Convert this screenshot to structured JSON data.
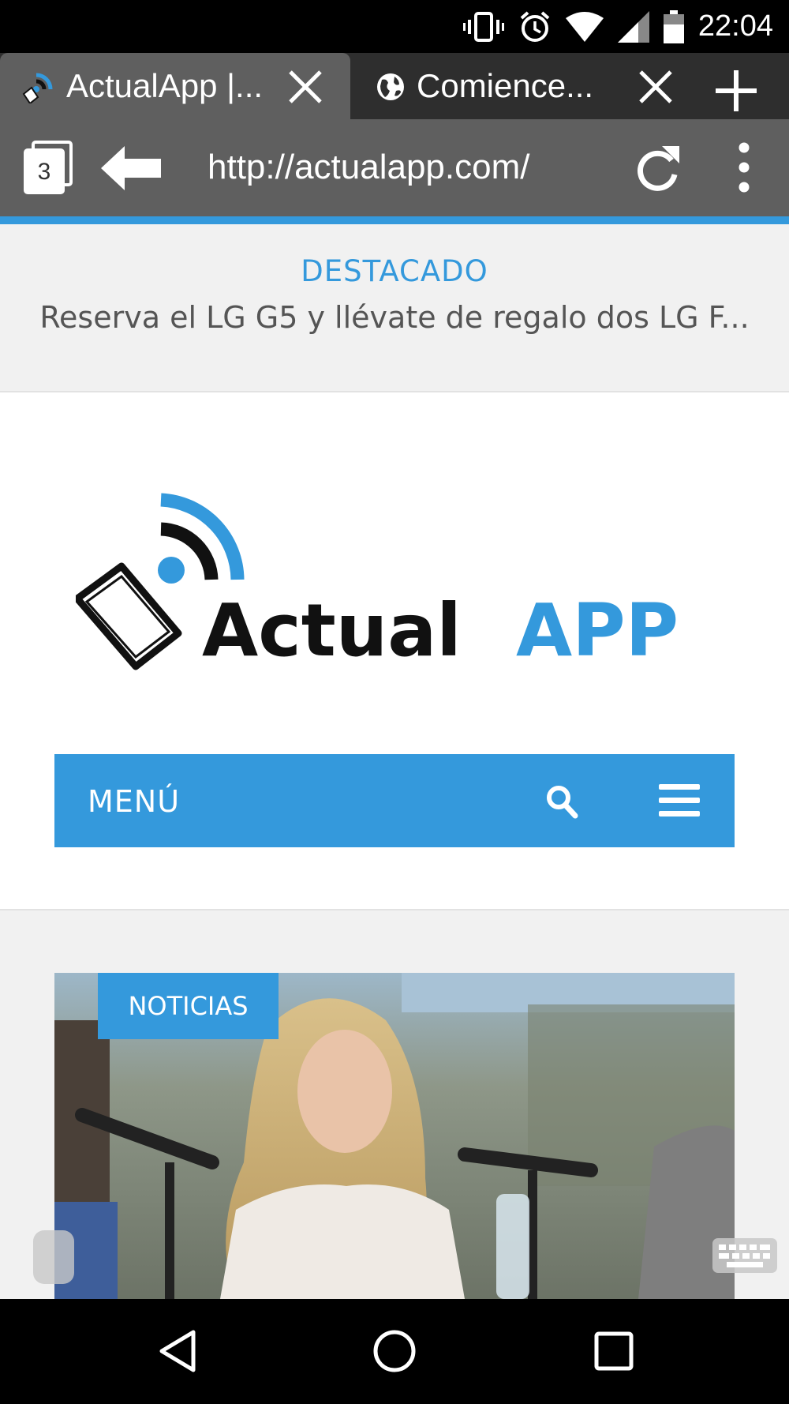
{
  "status_bar": {
    "time": "22:04",
    "icons": [
      "vibrate-icon",
      "alarm-icon",
      "wifi-icon",
      "signal-icon",
      "battery-icon"
    ]
  },
  "tabs": [
    {
      "title": "ActualApp |...",
      "active": true,
      "favicon": "actualapp-favicon"
    },
    {
      "title": "Comience...",
      "active": false,
      "favicon": "globe-icon"
    }
  ],
  "toolbar": {
    "tab_count": "3",
    "url": "http://actualapp.com/"
  },
  "featured": {
    "label": "DESTACADO",
    "headline": "Reserva el LG G5 y llévate de regalo dos LG F..."
  },
  "logo": {
    "word_dark": "Actual",
    "word_blue": "APP"
  },
  "menu": {
    "label": "MENÚ"
  },
  "article": {
    "category": "NOTICIAS"
  },
  "colors": {
    "accent": "#3499dc",
    "toolbar": "#5f5f5f",
    "tab_strip": "#2e2e2e"
  }
}
